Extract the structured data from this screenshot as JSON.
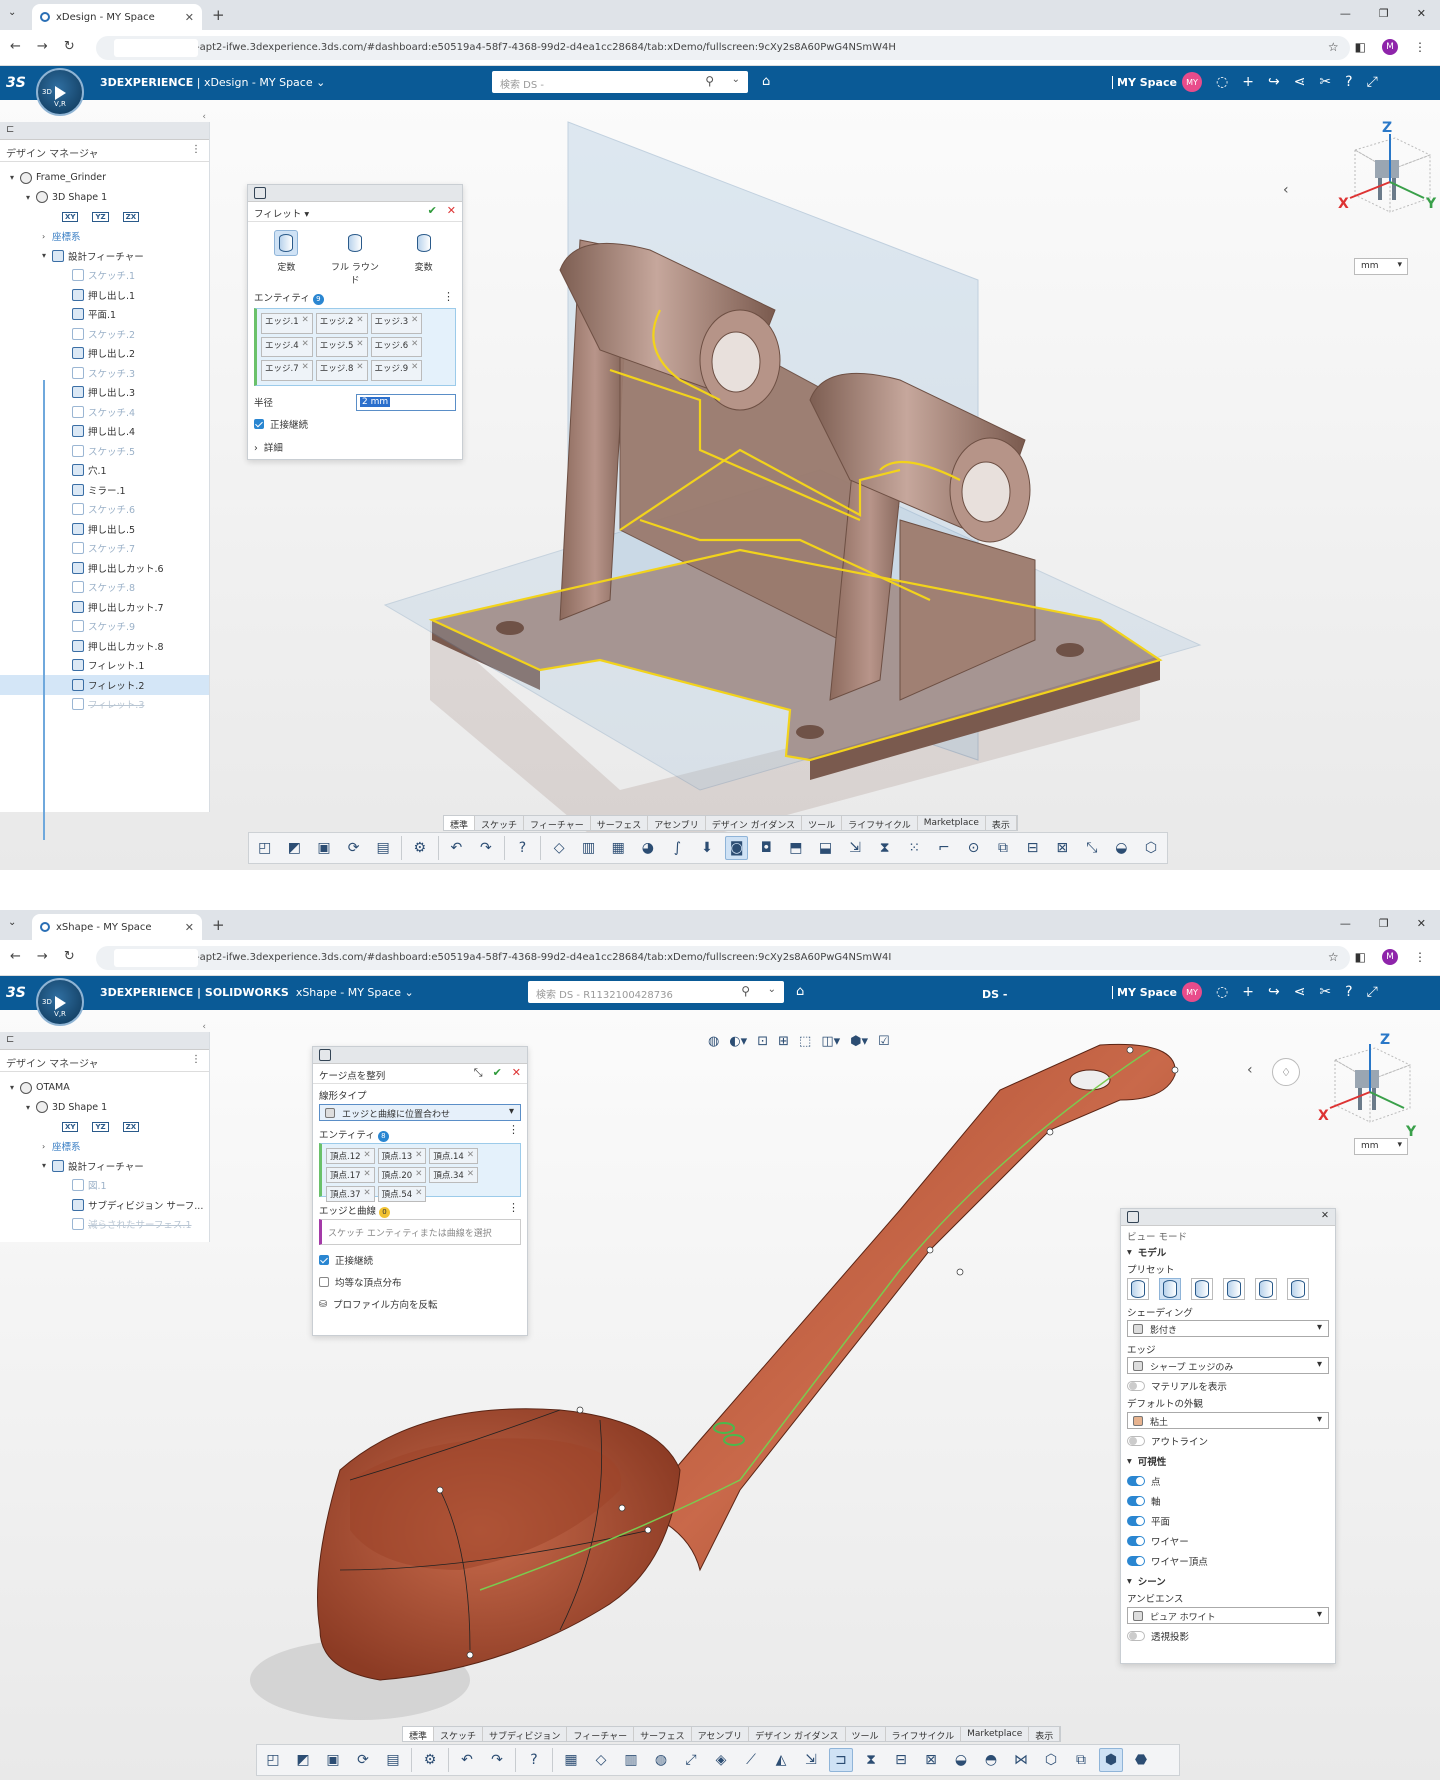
{
  "shot1": {
    "browser": {
      "tab_title": "xDesign - MY Space",
      "url": "-apt2-ifwe.3dexperience.3ds.com/#dashboard:e50519a4-58f7-4368-99d2-d4ea1cc28684/tab:xDemo/fullscreen:9cXy2s8A60PwG4NSmW4H",
      "profile_initial": "M"
    },
    "app": {
      "brand": "3DEXPERIENCE",
      "app_name": "xDesign - MY Space",
      "search_placeholder": "検索 DS -",
      "myspace": "MY Space",
      "avatar": "MY",
      "compass_label": "V,R",
      "compass_3d": "3D"
    },
    "tree": {
      "title": "デザイン マネージャ",
      "root": "Frame_Grinder",
      "shape": "3D Shape 1",
      "planes": [
        "XY",
        "YZ",
        "ZX"
      ],
      "coords": "座標系",
      "features_label": "設計フィーチャー",
      "features": [
        {
          "label": "スケッチ.1",
          "state": "dim"
        },
        {
          "label": "押し出し.1",
          "state": "normal"
        },
        {
          "label": "平面.1",
          "state": "normal"
        },
        {
          "label": "スケッチ.2",
          "state": "dim"
        },
        {
          "label": "押し出し.2",
          "state": "normal"
        },
        {
          "label": "スケッチ.3",
          "state": "dim"
        },
        {
          "label": "押し出し.3",
          "state": "normal"
        },
        {
          "label": "スケッチ.4",
          "state": "dim"
        },
        {
          "label": "押し出し.4",
          "state": "normal"
        },
        {
          "label": "スケッチ.5",
          "state": "dim"
        },
        {
          "label": "穴.1",
          "state": "normal"
        },
        {
          "label": "ミラー.1",
          "state": "normal"
        },
        {
          "label": "スケッチ.6",
          "state": "dim"
        },
        {
          "label": "押し出し.5",
          "state": "normal"
        },
        {
          "label": "スケッチ.7",
          "state": "dim"
        },
        {
          "label": "押し出しカット.6",
          "state": "normal"
        },
        {
          "label": "スケッチ.8",
          "state": "dim"
        },
        {
          "label": "押し出しカット.7",
          "state": "normal"
        },
        {
          "label": "スケッチ.9",
          "state": "dim"
        },
        {
          "label": "押し出しカット.8",
          "state": "normal"
        },
        {
          "label": "フィレット.1",
          "state": "normal"
        },
        {
          "label": "フィレット.2",
          "state": "sel"
        },
        {
          "label": "フィレット.3",
          "state": "strike"
        }
      ]
    },
    "fillet_panel": {
      "title": "フィレット",
      "types": [
        "定数",
        "フル ラウンド",
        "変数"
      ],
      "entities_label": "エンティティ",
      "entities_count": "9",
      "edges": [
        "エッジ.1",
        "エッジ.2",
        "エッジ.3",
        "エッジ.4",
        "エッジ.5",
        "エッジ.6",
        "エッジ.7",
        "エッジ.8",
        "エッジ.9"
      ],
      "radius_label": "半径",
      "radius_value": "2 mm",
      "tangent_label": "正接継続",
      "details_label": "詳細"
    },
    "units": "mm",
    "toolbar_tabs": [
      "標準",
      "スケッチ",
      "フィーチャー",
      "サーフェス",
      "アセンブリ",
      "デザイン ガイダンス",
      "ツール",
      "ライフサイクル",
      "Marketplace",
      "表示"
    ],
    "axes": {
      "x": "X",
      "y": "Y",
      "z": "Z"
    }
  },
  "shot2": {
    "browser": {
      "tab_title": "xShape - MY Space",
      "url": "-apt2-ifwe.3dexperience.3ds.com/#dashboard:e50519a4-58f7-4368-99d2-d4ea1cc28684/tab:xDemo/fullscreen:9cXy2s8A60PwG4NSmW4I",
      "profile_initial": "M"
    },
    "app": {
      "brand": "3DEXPERIENCE | SOLIDWORKS",
      "app_name": "xShape - MY Space",
      "search_placeholder": "検索 DS - R1132100428736",
      "ds_label": "DS -",
      "myspace": "MY Space",
      "avatar": "MY",
      "compass_label": "V,R",
      "compass_3d": "3D"
    },
    "tree": {
      "title": "デザイン マネージャ",
      "root": "OTAMA",
      "shape": "3D Shape 1",
      "planes": [
        "XY",
        "YZ",
        "ZX"
      ],
      "coords": "座標系",
      "features_label": "設計フィーチャー",
      "features": [
        {
          "label": "図.1",
          "state": "dim"
        },
        {
          "label": "サブディビジョン サーフ...",
          "state": "normal"
        },
        {
          "label": "減らされたサーフェス.1",
          "state": "strike"
        }
      ]
    },
    "cage_panel": {
      "title": "ケージ点を整列",
      "align_type_label": "線形タイプ",
      "align_type_value": "エッジと曲線に位置合わせ",
      "entities_label": "エンティティ",
      "entities_count": "8",
      "vertices": [
        "頂点.12",
        "頂点.13",
        "頂点.14",
        "頂点.17",
        "頂点.20",
        "頂点.34",
        "頂点.37",
        "頂点.54"
      ],
      "edges_label": "エッジと曲線",
      "edges_count": "0",
      "edges_placeholder": "スケッチ エンティティまたは曲線を選択",
      "tangent_label": "正接継続",
      "uniform_label": "均等な頂点分布",
      "reverse_label": "プロファイル方向を反転"
    },
    "view_panel": {
      "title": "ビュー モード",
      "model_label": "モデル",
      "preset_label": "プリセット",
      "shading_label": "シェーディング",
      "shading_value": "影付き",
      "edge_label": "エッジ",
      "edge_value": "シャープ エッジのみ",
      "material_label": "マテリアルを表示",
      "default_look_label": "デフォルトの外観",
      "default_look_value": "粘土",
      "outline_label": "アウトライン",
      "visibility_label": "可視性",
      "visibility_items": [
        "点",
        "軸",
        "平面",
        "ワイヤー",
        "ワイヤー頂点"
      ],
      "scene_label": "シーン",
      "ambience_label": "アンビエンス",
      "ambience_value": "ピュア ホワイト",
      "perspective_label": "透視投影"
    },
    "units": "mm",
    "toolbar_tabs": [
      "標準",
      "スケッチ",
      "サブディビジョン",
      "フィーチャー",
      "サーフェス",
      "アセンブリ",
      "デザイン ガイダンス",
      "ツール",
      "ライフサイクル",
      "Marketplace",
      "表示"
    ],
    "axes": {
      "x": "X",
      "y": "Y",
      "z": "Z"
    }
  },
  "colors": {
    "appbar": "#0a5a96",
    "model_bracket": "#a07a6a",
    "model_ladle": "#b5553a",
    "highlight": "#f2d31b",
    "plane": "#a9c6df"
  }
}
